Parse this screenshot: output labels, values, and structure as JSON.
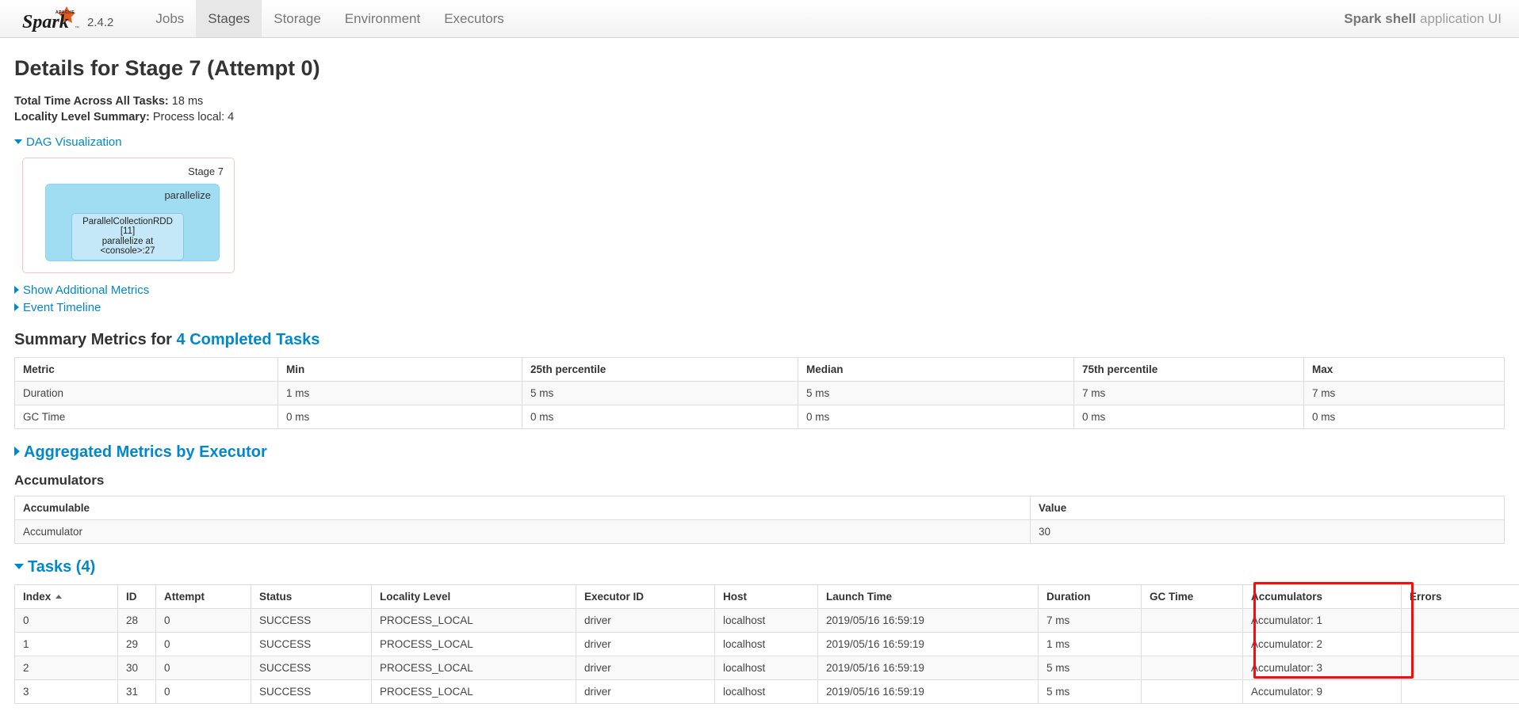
{
  "navbar": {
    "logo_alt": "Apache Spark",
    "logo_word": "Spark",
    "logo_super": "APACHE",
    "version": "2.4.2",
    "items": [
      {
        "label": "Jobs",
        "active": false
      },
      {
        "label": "Stages",
        "active": true
      },
      {
        "label": "Storage",
        "active": false
      },
      {
        "label": "Environment",
        "active": false
      },
      {
        "label": "Executors",
        "active": false
      }
    ],
    "app_name": "Spark shell",
    "app_suffix": "application UI"
  },
  "page": {
    "title": "Details for Stage 7 (Attempt 0)",
    "total_time_label": "Total Time Across All Tasks:",
    "total_time_value": "18 ms",
    "locality_label": "Locality Level Summary:",
    "locality_value": "Process local: 4"
  },
  "dag": {
    "toggle_label": "DAG Visualization",
    "stage_label": "Stage 7",
    "operation_label": "parallelize",
    "rdd_line1": "ParallelCollectionRDD [11]",
    "rdd_line2": "parallelize at <console>:27"
  },
  "metrics_toggles": {
    "show_additional_metrics": "Show Additional Metrics",
    "event_timeline": "Event Timeline"
  },
  "summary_metrics": {
    "heading_prefix": "Summary Metrics for",
    "heading_link": "4 Completed Tasks",
    "columns": [
      "Metric",
      "Min",
      "25th percentile",
      "Median",
      "75th percentile",
      "Max"
    ],
    "rows": [
      [
        "Duration",
        "1 ms",
        "5 ms",
        "5 ms",
        "7 ms",
        "7 ms"
      ],
      [
        "GC Time",
        "0 ms",
        "0 ms",
        "0 ms",
        "0 ms",
        "0 ms"
      ]
    ]
  },
  "aggregated_metrics": {
    "toggle_label": "Aggregated Metrics by Executor"
  },
  "accumulators": {
    "heading": "Accumulators",
    "columns": [
      "Accumulable",
      "Value"
    ],
    "rows": [
      [
        "Accumulator",
        "30"
      ]
    ]
  },
  "tasks": {
    "toggle_label": "Tasks (4)",
    "columns": [
      "Index",
      "ID",
      "Attempt",
      "Status",
      "Locality Level",
      "Executor ID",
      "Host",
      "Launch Time",
      "Duration",
      "GC Time",
      "Accumulators",
      "Errors"
    ],
    "sorted_column": "Index",
    "sort_direction": "asc",
    "rows": [
      {
        "index": "0",
        "id": "28",
        "attempt": "0",
        "status": "SUCCESS",
        "locality": "PROCESS_LOCAL",
        "executor": "driver",
        "host": "localhost",
        "launch": "2019/05/16 16:59:19",
        "duration": "7 ms",
        "gc": "",
        "accumulators": "Accumulator: 1",
        "errors": ""
      },
      {
        "index": "1",
        "id": "29",
        "attempt": "0",
        "status": "SUCCESS",
        "locality": "PROCESS_LOCAL",
        "executor": "driver",
        "host": "localhost",
        "launch": "2019/05/16 16:59:19",
        "duration": "1 ms",
        "gc": "",
        "accumulators": "Accumulator: 2",
        "errors": ""
      },
      {
        "index": "2",
        "id": "30",
        "attempt": "0",
        "status": "SUCCESS",
        "locality": "PROCESS_LOCAL",
        "executor": "driver",
        "host": "localhost",
        "launch": "2019/05/16 16:59:19",
        "duration": "5 ms",
        "gc": "",
        "accumulators": "Accumulator: 3",
        "errors": ""
      },
      {
        "index": "3",
        "id": "31",
        "attempt": "0",
        "status": "SUCCESS",
        "locality": "PROCESS_LOCAL",
        "executor": "driver",
        "host": "localhost",
        "launch": "2019/05/16 16:59:19",
        "duration": "5 ms",
        "gc": "",
        "accumulators": "Accumulator: 9",
        "errors": ""
      }
    ]
  },
  "annotation": {
    "highlight_color": "#fd0b0b",
    "highlight_target": "Accumulators column"
  },
  "colors": {
    "link": "#0088cc",
    "dag_border": "#f7c5c5",
    "dag_fill": "#a0ddf3",
    "rdd_fill": "#c4e8f7",
    "nav_active": "#e7e7e7"
  }
}
